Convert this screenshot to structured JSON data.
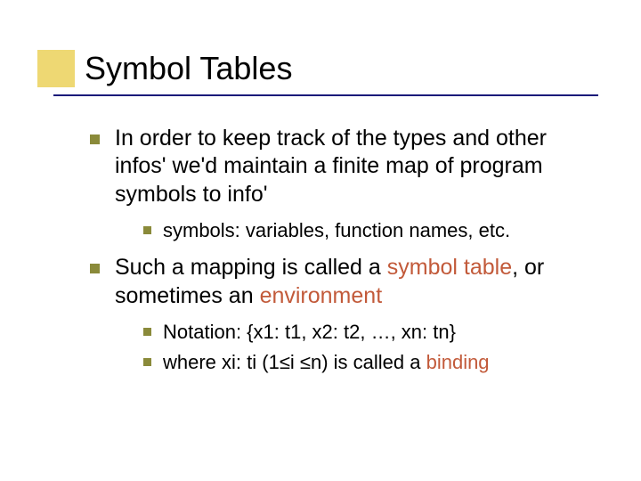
{
  "title": "Symbol Tables",
  "bullets": {
    "b1": {
      "text": "In order to keep track of the types and other infos' we'd maintain a finite map of program symbols to info'",
      "sub": {
        "s1": "symbols: variables, function names, etc."
      }
    },
    "b2": {
      "pre": "Such a mapping is called a ",
      "em1": "symbol table",
      "mid": ", or sometimes an ",
      "em2": "environment",
      "sub": {
        "s1": "Notation: {x1: t1, x2: t2, …, xn: tn}",
        "s2_pre": "where xi: ti (1≤i ≤n) is called a ",
        "s2_em": "binding"
      }
    }
  }
}
